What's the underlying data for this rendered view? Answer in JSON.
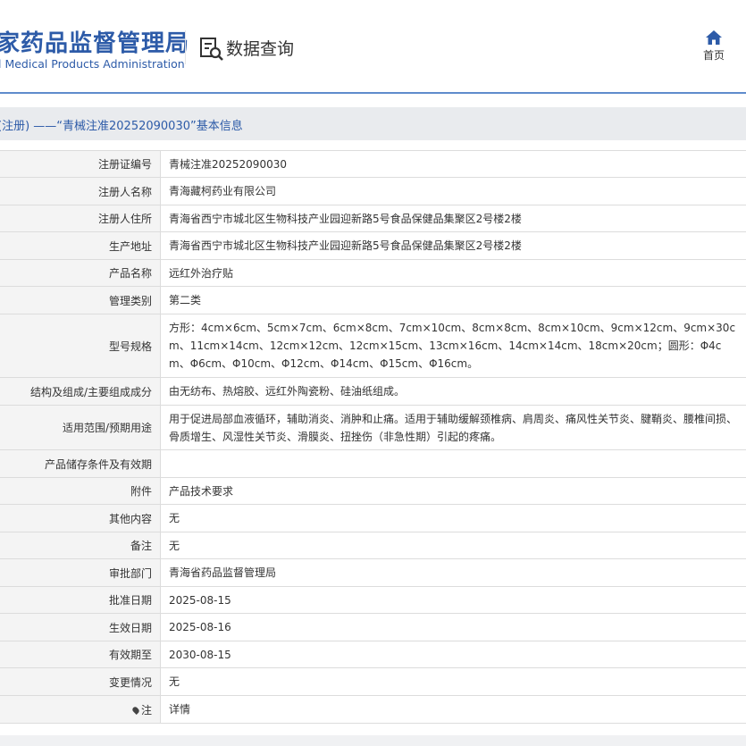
{
  "header": {
    "brand_cn": "家药品监督管理局",
    "brand_en": "l Medical Products Administration",
    "query_label": "数据查询",
    "home_label": "首页"
  },
  "subtitle": "(注册) ——“青械注准20252090030”基本信息",
  "rows": [
    {
      "label": "注册证编号",
      "value": "青械注准20252090030"
    },
    {
      "label": "注册人名称",
      "value": "青海藏柯药业有限公司"
    },
    {
      "label": "注册人住所",
      "value": "青海省西宁市城北区生物科技产业园迎新路5号食品保健品集聚区2号楼2楼"
    },
    {
      "label": "生产地址",
      "value": "青海省西宁市城北区生物科技产业园迎新路5号食品保健品集聚区2号楼2楼"
    },
    {
      "label": "产品名称",
      "value": "远红外治疗贴"
    },
    {
      "label": "管理类别",
      "value": "第二类"
    },
    {
      "label": "型号规格",
      "value": "方形：4cm×6cm、5cm×7cm、6cm×8cm、7cm×10cm、8cm×8cm、8cm×10cm、9cm×12cm、9cm×30cm、11cm×14cm、12cm×12cm、12cm×15cm、13cm×16cm、14cm×14cm、18cm×20cm；圆形：Φ4cm、Φ6cm、Φ10cm、Φ12cm、Φ14cm、Φ15cm、Φ16cm。"
    },
    {
      "label": "结构及组成/主要组成成分",
      "value": "由无纺布、热熔胶、远红外陶瓷粉、硅油纸组成。"
    },
    {
      "label": "适用范围/预期用途",
      "value": "用于促进局部血液循环，辅助消炎、消肿和止痛。适用于辅助缓解颈椎病、肩周炎、痛风性关节炎、腱鞘炎、腰椎间损、骨质增生、风湿性关节炎、滑膜炎、扭挫伤（非急性期）引起的疼痛。"
    },
    {
      "label": "产品储存条件及有效期",
      "value": ""
    },
    {
      "label": "附件",
      "value": "产品技术要求"
    },
    {
      "label": "其他内容",
      "value": "无"
    },
    {
      "label": "备注",
      "value": "无"
    },
    {
      "label": "审批部门",
      "value": "青海省药品监督管理局"
    },
    {
      "label": "批准日期",
      "value": "2025-08-15"
    },
    {
      "label": "生效日期",
      "value": "2025-08-16"
    },
    {
      "label": "有效期至",
      "value": "2030-08-15"
    },
    {
      "label": "变更情况",
      "value": "无"
    },
    {
      "label": "注",
      "value": "详情"
    }
  ]
}
